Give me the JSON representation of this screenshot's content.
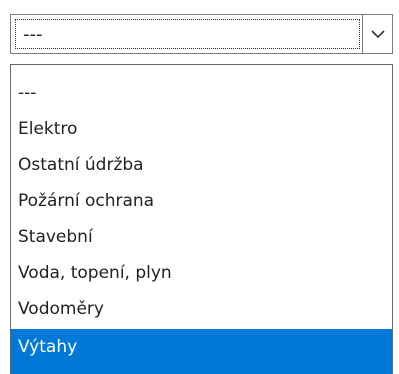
{
  "select": {
    "current_value": "---",
    "arrow_icon": "chevron-down-icon"
  },
  "dropdown": {
    "options": [
      {
        "label": "---",
        "selected": false
      },
      {
        "label": "Elektro",
        "selected": false
      },
      {
        "label": "Ostatní údržba",
        "selected": false
      },
      {
        "label": "Požární ochrana",
        "selected": false
      },
      {
        "label": "Stavební",
        "selected": false
      },
      {
        "label": "Voda, topení, plyn",
        "selected": false
      },
      {
        "label": "Vodoměry",
        "selected": false
      },
      {
        "label": "Výtahy",
        "selected": true
      }
    ]
  },
  "colors": {
    "selected_option_background": "#0078d7",
    "selected_option_text": "#ffffff",
    "border": "#7a7a7a"
  }
}
